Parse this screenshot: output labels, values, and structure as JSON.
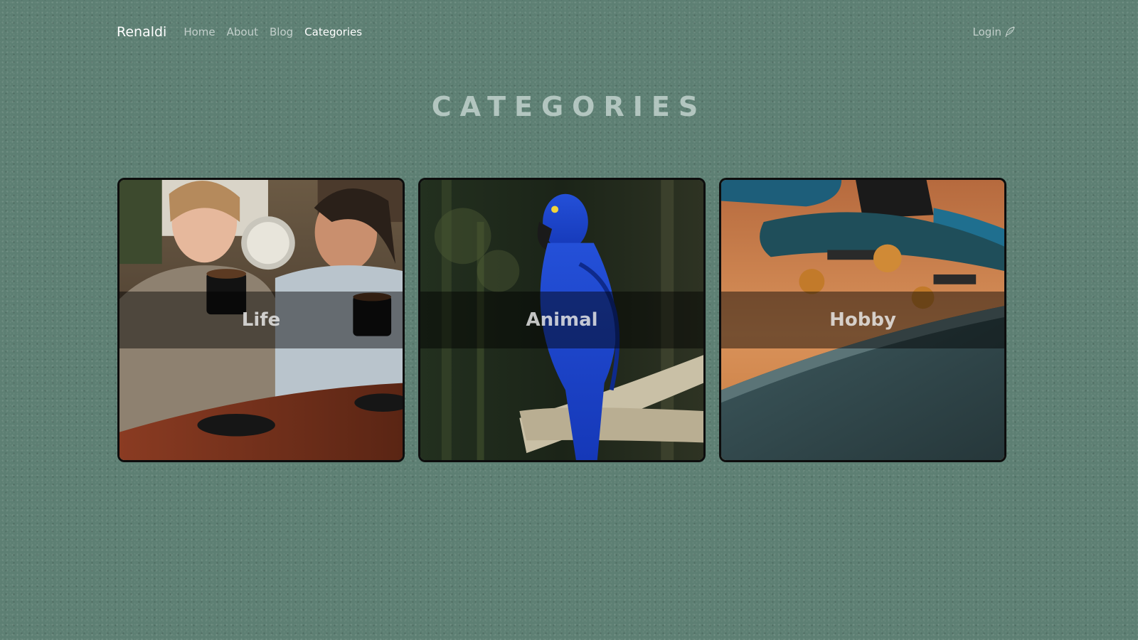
{
  "nav": {
    "brand": "Renaldi",
    "links": [
      {
        "label": "Home",
        "active": false
      },
      {
        "label": "About",
        "active": false
      },
      {
        "label": "Blog",
        "active": false
      },
      {
        "label": "Categories",
        "active": true
      }
    ],
    "login_label": "Login",
    "login_icon": "feather-icon"
  },
  "page": {
    "title": "CATEGORIES"
  },
  "categories": [
    {
      "label": "Life",
      "image": "two-women-laughing-with-coffee-cups"
    },
    {
      "label": "Animal",
      "image": "blue-hyacinth-macaw-on-branch"
    },
    {
      "label": "Hobby",
      "image": "skateboard-on-ledge"
    }
  ],
  "colors": {
    "background": "#5d7f73",
    "card_border": "#0d0d0d",
    "active_link": "#ffffff"
  }
}
